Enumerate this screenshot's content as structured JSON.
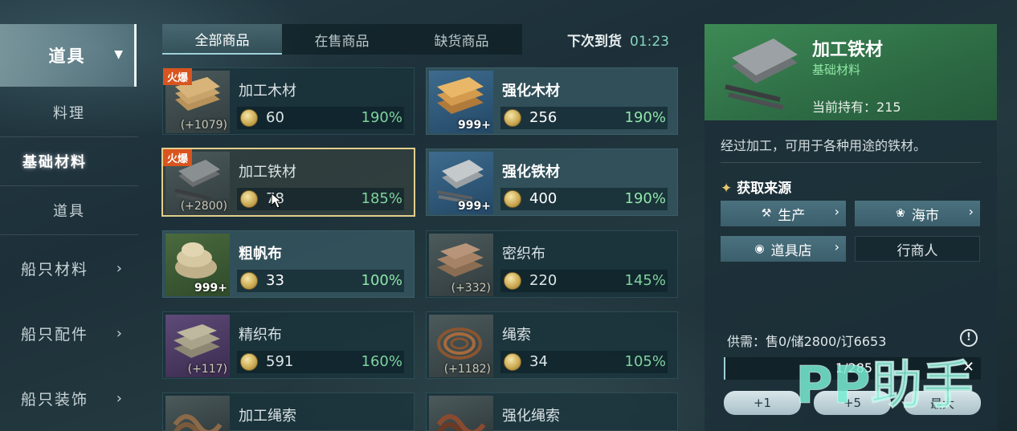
{
  "sidebar": {
    "top_label": "道具",
    "sub_items": [
      "料理",
      "基础材料",
      "道具"
    ],
    "categories": [
      "船只材料",
      "船只配件",
      "船只装饰"
    ]
  },
  "tabs": [
    "全部商品",
    "在售商品",
    "缺货商品"
  ],
  "restock": {
    "label": "下次到货",
    "time": "01:23"
  },
  "items": [
    {
      "name": "加工木材",
      "price": "60",
      "pct": "190%",
      "count": "(+1079)",
      "hot": "火爆"
    },
    {
      "name": "强化木材",
      "price": "256",
      "pct": "190%",
      "count": "999+"
    },
    {
      "name": "加工铁材",
      "price": "78",
      "pct": "185%",
      "count": "(+2800)",
      "hot": "火爆"
    },
    {
      "name": "强化铁材",
      "price": "400",
      "pct": "190%",
      "count": "999+"
    },
    {
      "name": "粗帆布",
      "price": "33",
      "pct": "100%",
      "count": "999+"
    },
    {
      "name": "密织布",
      "price": "220",
      "pct": "145%",
      "count": "(+332)"
    },
    {
      "name": "精织布",
      "price": "591",
      "pct": "160%",
      "count": "(+117)"
    },
    {
      "name": "绳索",
      "price": "34",
      "pct": "105%",
      "count": "(+1182)"
    },
    {
      "name": "加工绳索"
    },
    {
      "name": "强化绳索"
    }
  ],
  "detail": {
    "title": "加工铁材",
    "subtitle": "基础材料",
    "holding_label": "当前持有：",
    "holding": "215",
    "description": "经过加工，可用于各种用途的铁材。",
    "source_title": "获取来源",
    "sources": [
      "生产",
      "海市",
      "道具店",
      "行商人"
    ],
    "supply": "供需：售0/储2800/订6653",
    "quantity": "1/285",
    "qty_buttons": [
      "+1",
      "+5",
      "最大"
    ]
  },
  "watermark": "PP助手",
  "colors": {
    "accent_green": "#7fd39e",
    "hot_badge": "#d9541e",
    "selected_border": "#e2cf8d",
    "detail_header": "#3d8a55"
  }
}
